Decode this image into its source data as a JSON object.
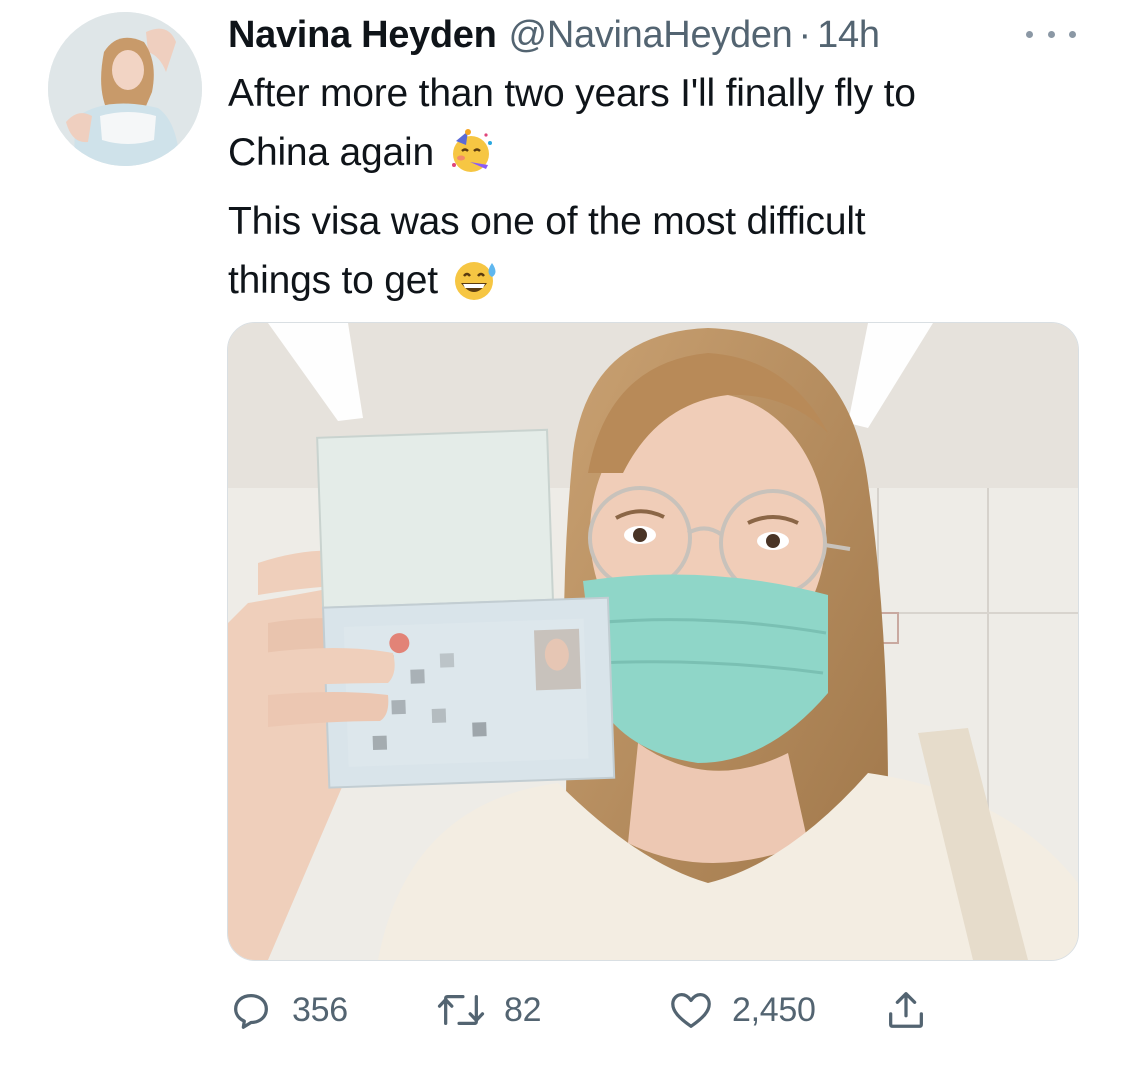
{
  "tweet": {
    "display_name": "Navina Heyden",
    "handle": "@NavinaHeyden",
    "separator": "·",
    "time": "14h",
    "more_icon": "more-horizontal-icon",
    "text_lines": [
      "After more than two years I'll finally fly to",
      "China again",
      "This visa was one of the most difficult",
      "things to get"
    ],
    "emojis": [
      "partying-face-emoji",
      "grinning-sweat-emoji"
    ],
    "media_alt": "photo-woman-with-mask-holding-passport"
  },
  "actions": {
    "reply": {
      "icon": "reply-icon",
      "count": "356"
    },
    "retweet": {
      "icon": "retweet-icon",
      "count": "82"
    },
    "like": {
      "icon": "heart-icon",
      "count": "2,450"
    },
    "share": {
      "icon": "share-icon"
    }
  },
  "colors": {
    "text_primary": "#0f1419",
    "text_secondary": "#536471",
    "mask": "#8fd6c8"
  }
}
